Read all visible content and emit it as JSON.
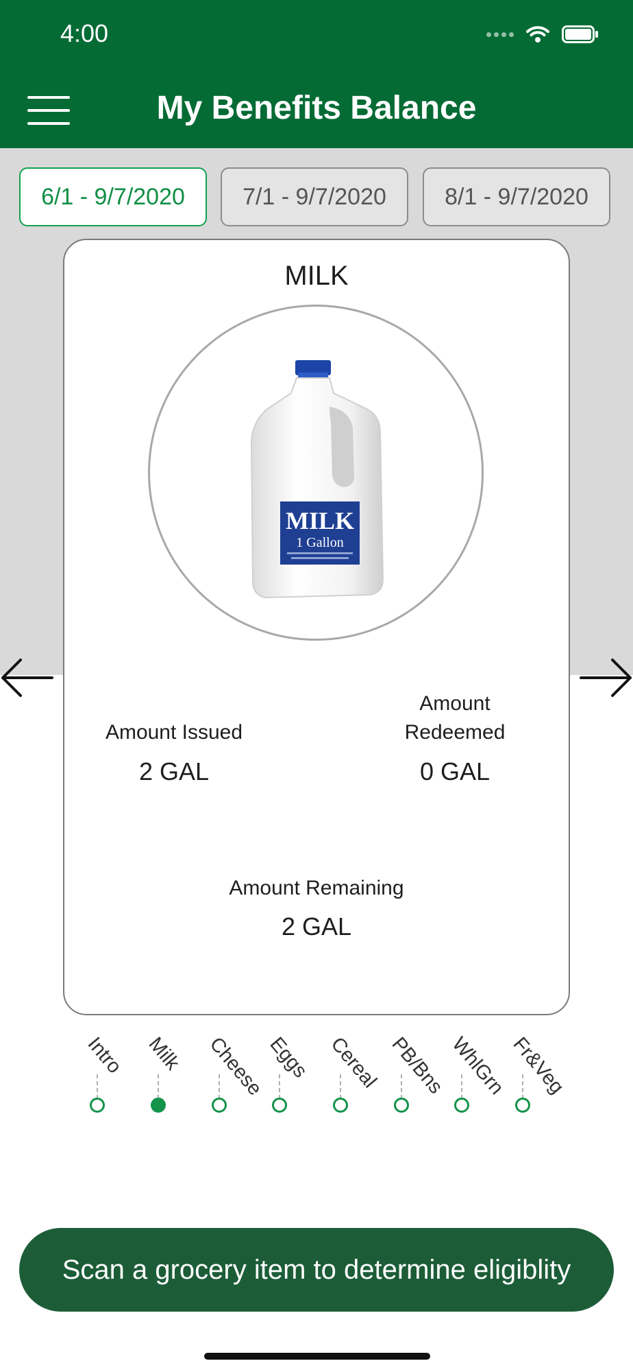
{
  "status_bar": {
    "time": "4:00"
  },
  "header": {
    "title": "My Benefits Balance"
  },
  "date_tabs": [
    {
      "label": "6/1 - 9/7/2020",
      "selected": true
    },
    {
      "label": "7/1 - 9/7/2020",
      "selected": false
    },
    {
      "label": "8/1 - 9/7/2020",
      "selected": false
    }
  ],
  "card": {
    "title": "MILK",
    "image_label": {
      "brand": "MILK",
      "size": "1 Gallon"
    },
    "amount_issued": {
      "label": "Amount Issued",
      "value": "2 GAL"
    },
    "amount_redeemed": {
      "label_line1": "Amount",
      "label_line2": "Redeemed",
      "value": "0 GAL"
    },
    "amount_remaining": {
      "label": "Amount Remaining",
      "value": "2 GAL"
    }
  },
  "nav": {
    "prev_icon": "arrow-left-icon",
    "next_icon": "arrow-right-icon"
  },
  "pager": {
    "items": [
      "Intro",
      "Milk",
      "Cheese",
      "Eggs",
      "Cereal",
      "PB/Bns",
      "WhlGrn",
      "Fr&Veg"
    ],
    "active_index": 1
  },
  "scan_button": {
    "label": "Scan a grocery item to determine eligiblity"
  },
  "colors": {
    "header_green": "#056b35",
    "accent_green": "#14934a",
    "button_green": "#1c5d38",
    "band_gray": "#d9d9d9"
  }
}
